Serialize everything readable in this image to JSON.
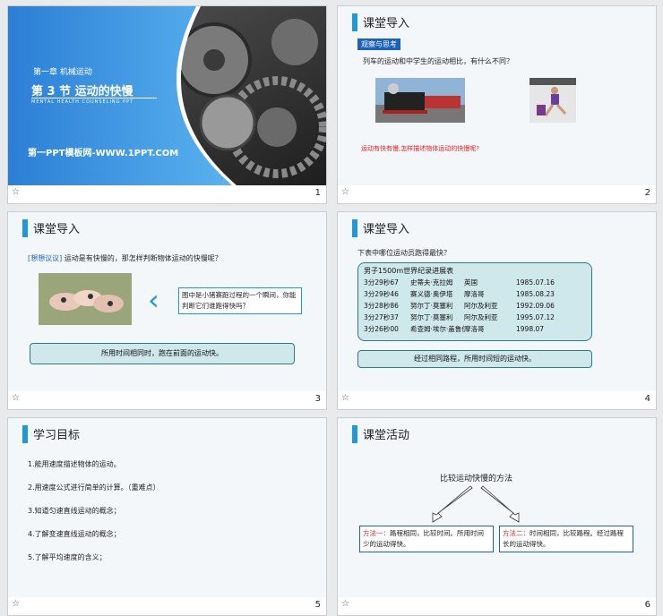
{
  "slides": [
    {
      "num": "1",
      "chapter": "第一章 机械运动",
      "section_title": "第 3 节   运动的快慢",
      "subtitle_en": "MENTAL HEALTH COUNSELING PPT",
      "brand": "第一PPT模板网-WWW.1PPT.COM"
    },
    {
      "num": "2",
      "title": "课堂导入",
      "tag": "观察与思考",
      "question": "列车的运动和中学生的运动相比，有什么不同？",
      "red_question": "运动有快有慢,怎样描述物体运动的快慢呢?"
    },
    {
      "num": "3",
      "title": "课堂导入",
      "prompt_bracket": "[想想议议]",
      "prompt": "运动是有快慢的，那怎样判断物体运动的快慢呢？",
      "callout": "图中是小猪赛跑过程的一个瞬间，你能判断它们谁跑得快吗？",
      "answer": "所用时间相同时，跑在前面的运动快。"
    },
    {
      "num": "4",
      "title": "课堂导入",
      "question": "下表中哪位运动员跑得最快？",
      "table_title": "男子1500m世界纪录进展表",
      "rows": [
        [
          "3分29秒67",
          "史蒂夫·克拉姆",
          "英国",
          "1985.07.16"
        ],
        [
          "3分29秒46",
          "赛义德·奥伊塔",
          "摩洛哥",
          "1985.08.23"
        ],
        [
          "3分28秒86",
          "努尔丁·莫塞利",
          "阿尔及利亚",
          "1992.09.06"
        ],
        [
          "3分27秒37",
          "努尔丁·莫塞利",
          "阿尔及利亚",
          "1995.07.12"
        ],
        [
          "3分26秒00",
          "希查姆·埃尔·盖鲁伊",
          "摩洛哥",
          "1998.07"
        ]
      ],
      "answer": "经过相同路程，所用时间短的运动快。"
    },
    {
      "num": "5",
      "title": "学习目标",
      "items": [
        "1.能用速度描述物体的运动。",
        "2.用速度公式进行简单的计算。（重难点）",
        "3.知道匀速直线运动的概念；",
        "4.了解变速直线运动的概念；",
        "5.了解平均速度的含义；"
      ]
    },
    {
      "num": "6",
      "title": "课堂活动",
      "center": "比较运动快慢的方法",
      "m1_label": "方法一：",
      "m1_text": "路程相同，比较时间。所用时间少的运动得快。",
      "m2_label": "方法二：",
      "m2_text": "时间相同，比较路程。经过路程长的运动得快。"
    }
  ],
  "colors": {
    "accent": "#1d9ad6",
    "teal": "#cfe8ec",
    "red": "#e02020"
  }
}
